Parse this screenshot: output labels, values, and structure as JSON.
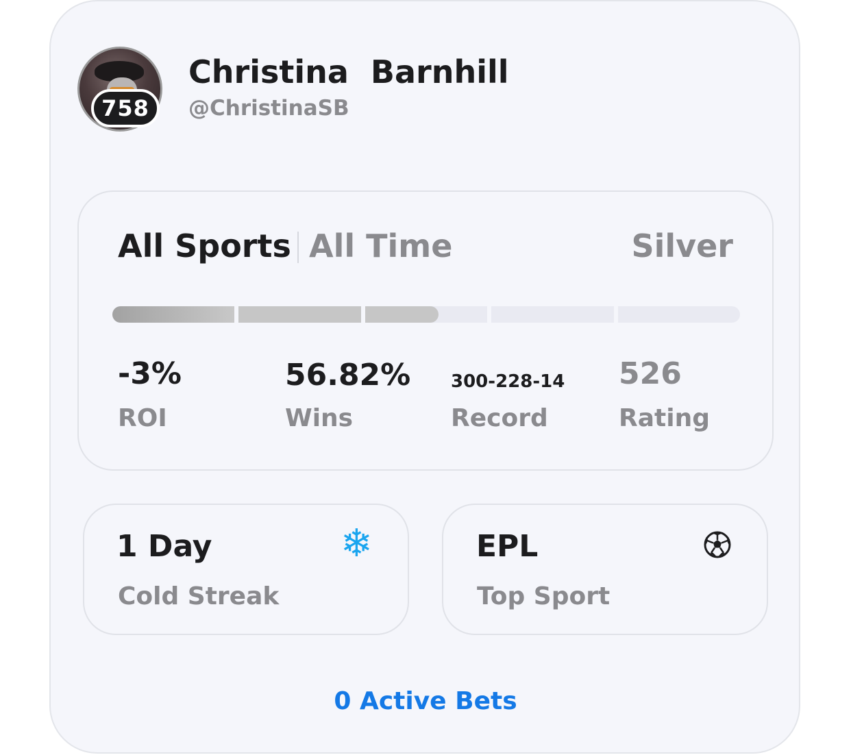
{
  "profile": {
    "first_name": "Christina",
    "last_name": "Barnhill",
    "handle": "@ChristinaSB",
    "rank": "758"
  },
  "filters": {
    "sport": "All Sports",
    "period": "All Time"
  },
  "tier": {
    "label": "Silver",
    "progress_segments": 5,
    "progress_fraction": 0.52
  },
  "stats": [
    {
      "value": "-3%",
      "label": "ROI"
    },
    {
      "value": "56.82%",
      "label": "Wins"
    },
    {
      "value": "300-228-14",
      "label": "Record"
    },
    {
      "value": "526",
      "label": "Rating"
    }
  ],
  "tiles": {
    "streak": {
      "value": "1 Day",
      "label": "Cold Streak",
      "icon": "snowflake-icon",
      "icon_color": "#1aa5ef"
    },
    "top_sport": {
      "value": "EPL",
      "label": "Top Sport",
      "icon": "soccer-ball-icon"
    }
  },
  "active_bets": "0 Active Bets",
  "colors": {
    "accent": "#1479e6",
    "card_bg": "#f5f6fb",
    "muted_text": "#8a8a8e"
  }
}
